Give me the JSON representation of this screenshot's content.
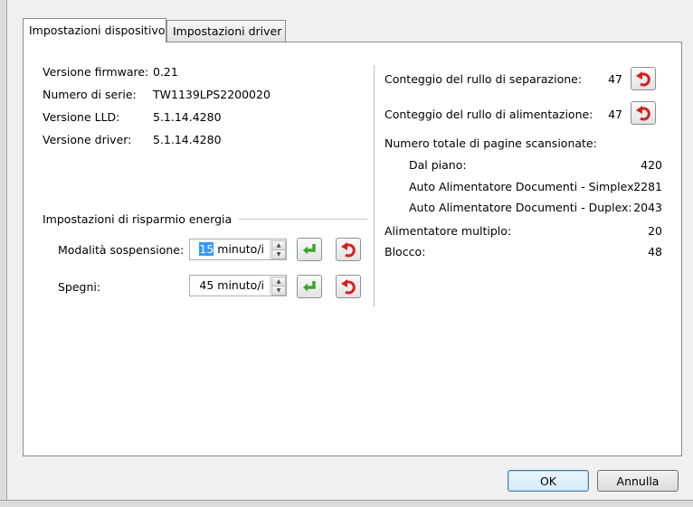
{
  "tabs": [
    {
      "label": "Impostazioni dispositivo"
    },
    {
      "label": "Impostazioni driver"
    }
  ],
  "device_info": {
    "firmware_label": "Versione firmware:",
    "firmware_value": "0.21",
    "serial_label": "Numero di serie:",
    "serial_value": "TW1139LPS2200020",
    "lld_label": "Versione LLD:",
    "lld_value": "5.1.14.4280",
    "driver_label": "Versione driver:",
    "driver_value": "5.1.14.4280"
  },
  "power_saving": {
    "group_title": "Impostazioni di risparmio energia",
    "sleep_label": "Modalità sospensione:",
    "sleep_value": "15",
    "sleep_unit": " minuto/i",
    "off_label": "Spegni:",
    "off_value": "45",
    "off_unit": " minuto/i"
  },
  "counters": {
    "separation_label": "Conteggio del rullo di separazione:",
    "separation_value": "47",
    "feed_label": "Conteggio del rullo di alimentazione:",
    "feed_value": "47",
    "total_label": "Numero totale di pagine scansionate:",
    "flatbed_label": "Dal piano:",
    "flatbed_value": "420",
    "adf_simplex_label": "Auto Alimentatore Documenti - Simplex:",
    "adf_simplex_value": "2281",
    "adf_duplex_label": "Auto Alimentatore Documenti - Duplex:",
    "adf_duplex_value": "2043",
    "multifeed_label": "Alimentatore multiplo:",
    "multifeed_value": "20",
    "jam_label": "Blocco:",
    "jam_value": "48"
  },
  "buttons": {
    "ok": "OK",
    "cancel": "Annulla"
  },
  "icons": {
    "apply": "apply-green-arrow-icon",
    "reset": "reset-red-undo-icon"
  },
  "colors": {
    "apply_green": "#3aa62a",
    "reset_red": "#d62020",
    "selection": "#3399ff"
  }
}
